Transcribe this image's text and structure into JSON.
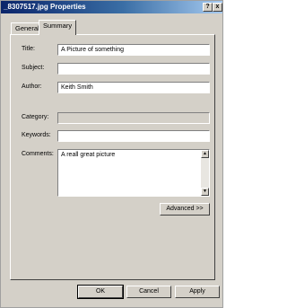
{
  "window": {
    "title": "_8307517.jpg Properties",
    "help_label": "?",
    "close_label": "x"
  },
  "tabs": [
    {
      "label": "General"
    },
    {
      "label": "Summary"
    }
  ],
  "fields": {
    "title": {
      "label": "Title:",
      "value": "A Picture of something"
    },
    "subject": {
      "label": "Subject:",
      "value": ""
    },
    "author": {
      "label": "Author:",
      "value": "Keith Smith"
    },
    "category": {
      "label": "Category:",
      "value": ""
    },
    "keywords": {
      "label": "Keywords:",
      "value": ""
    },
    "comments": {
      "label": "Comments:",
      "value": "A reall great picture"
    }
  },
  "scroll": {
    "up_icon": "▲",
    "down_icon": "▼"
  },
  "buttons": {
    "advanced": "Advanced >>",
    "ok": "OK",
    "cancel": "Cancel",
    "apply": "Apply"
  }
}
